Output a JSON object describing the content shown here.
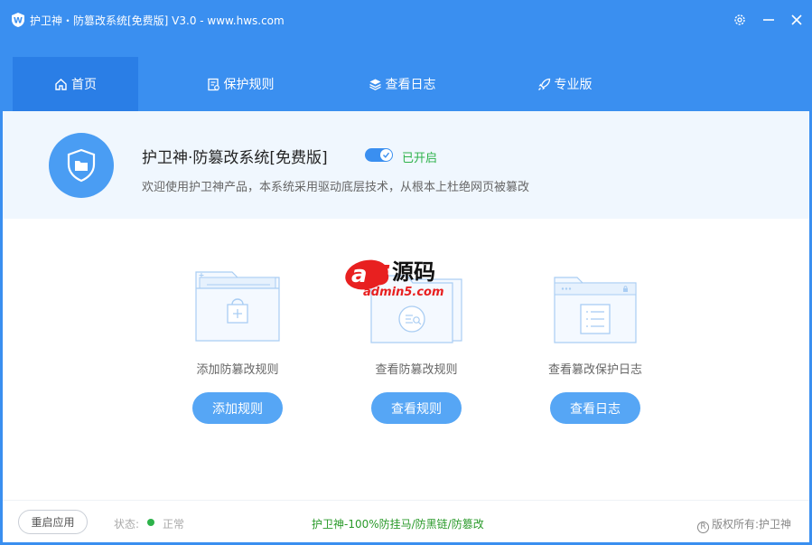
{
  "window": {
    "title": "护卫神・防篡改系统[免费版] V3.0 - www.hws.com",
    "icons": [
      "shield-w-logo",
      "gear-icon",
      "minimize-icon",
      "close-icon"
    ]
  },
  "nav": {
    "tabs": [
      {
        "label": "首页",
        "icon": "home-icon",
        "active": true
      },
      {
        "label": "保护规则",
        "icon": "rules-icon",
        "active": false
      },
      {
        "label": "查看日志",
        "icon": "layers-icon",
        "active": false
      },
      {
        "label": "专业版",
        "icon": "rocket-icon",
        "active": false
      }
    ]
  },
  "banner": {
    "title": "护卫神·防篡改系统[免费版]",
    "toggle_on": true,
    "status": "已开启",
    "description": "欢迎使用护卫神产品，本系统采用驱动底层技术，从根本上杜绝网页被篡改"
  },
  "cards": [
    {
      "label": "添加防篡改规则",
      "button": "添加规则",
      "icon": "folder-lock-icon"
    },
    {
      "label": "查看防篡改规则",
      "button": "查看规则",
      "icon": "folder-search-icon"
    },
    {
      "label": "查看篡改保护日志",
      "button": "查看日志",
      "icon": "browser-list-icon"
    }
  ],
  "watermark": {
    "brand": "a5源码",
    "domain": "admin5.com"
  },
  "footer": {
    "restart_label": "重启应用",
    "status_label": "状态:",
    "status_value": "正常",
    "slogan": "护卫神-100%防挂马/防黑链/防篡改",
    "copyright": "版权所有:护卫神",
    "copyright_symbol": "R"
  },
  "colors": {
    "primary": "#3a8ff0",
    "active_tab": "#2a7ee6",
    "button": "#56a6f5",
    "success": "#2db24a",
    "slogan": "#2a9a2a"
  }
}
